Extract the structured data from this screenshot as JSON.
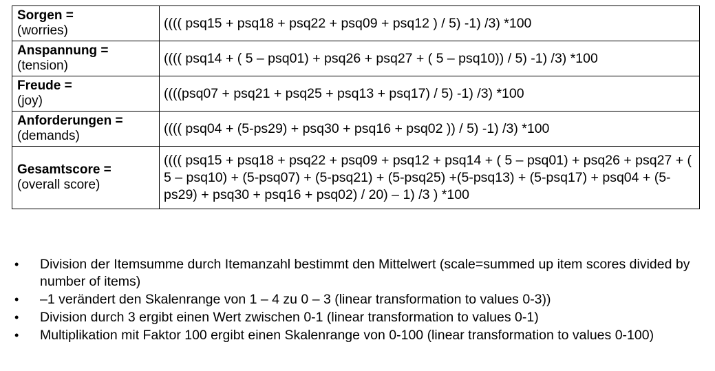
{
  "table": {
    "rows": [
      {
        "name": "Sorgen =",
        "english": "(worries)",
        "formula": "(((( psq15 + psq18 + psq22 + psq09 + psq12 ) / 5) -1) /3) *100"
      },
      {
        "name": "Anspannung =",
        "english": "(tension)",
        "formula": "(((( psq14 + ( 5 – psq01)  + psq26 + psq27 + ( 5 – psq10)) / 5) -1) /3) *100"
      },
      {
        "name": "Freude =",
        "english": "(joy)",
        "formula": "((((psq07 + psq21 + psq25 + psq13 + psq17) / 5) -1) /3) *100"
      },
      {
        "name": "Anforderungen =",
        "english": "(demands)",
        "formula": "(((( psq04 + (5-ps29) + psq30 + psq16 + psq02 )) / 5) -1) /3) *100"
      },
      {
        "name": "Gesamtscore =",
        "english": "(overall score)",
        "formula": "(((( psq15 + psq18 + psq22 + psq09 + psq12 + psq14 + ( 5 – psq01)  + psq26 + psq27 + ( 5 – psq10) + (5-psq07) + (5-psq21) + (5-psq25) +(5-psq13) + (5-psq17) + psq04 + (5-ps29) + psq30 + psq16 + psq02) / 20) – 1) /3 ) *100"
      }
    ]
  },
  "notes": {
    "bullet_glyph": "•",
    "items": [
      "Division der Itemsumme durch Itemanzahl bestimmt den Mittelwert (scale=summed up item scores divided by number of items)",
      "–1 verändert den Skalenrange von 1 – 4 zu  0 – 3 (linear transformation to values 0-3))",
      "Division durch 3 ergibt einen Wert zwischen 0-1 (linear transformation to values 0-1)",
      "Multiplikation mit Faktor 100 ergibt einen Skalenrange von 0-100 (linear transformation to values 0-100)"
    ]
  }
}
